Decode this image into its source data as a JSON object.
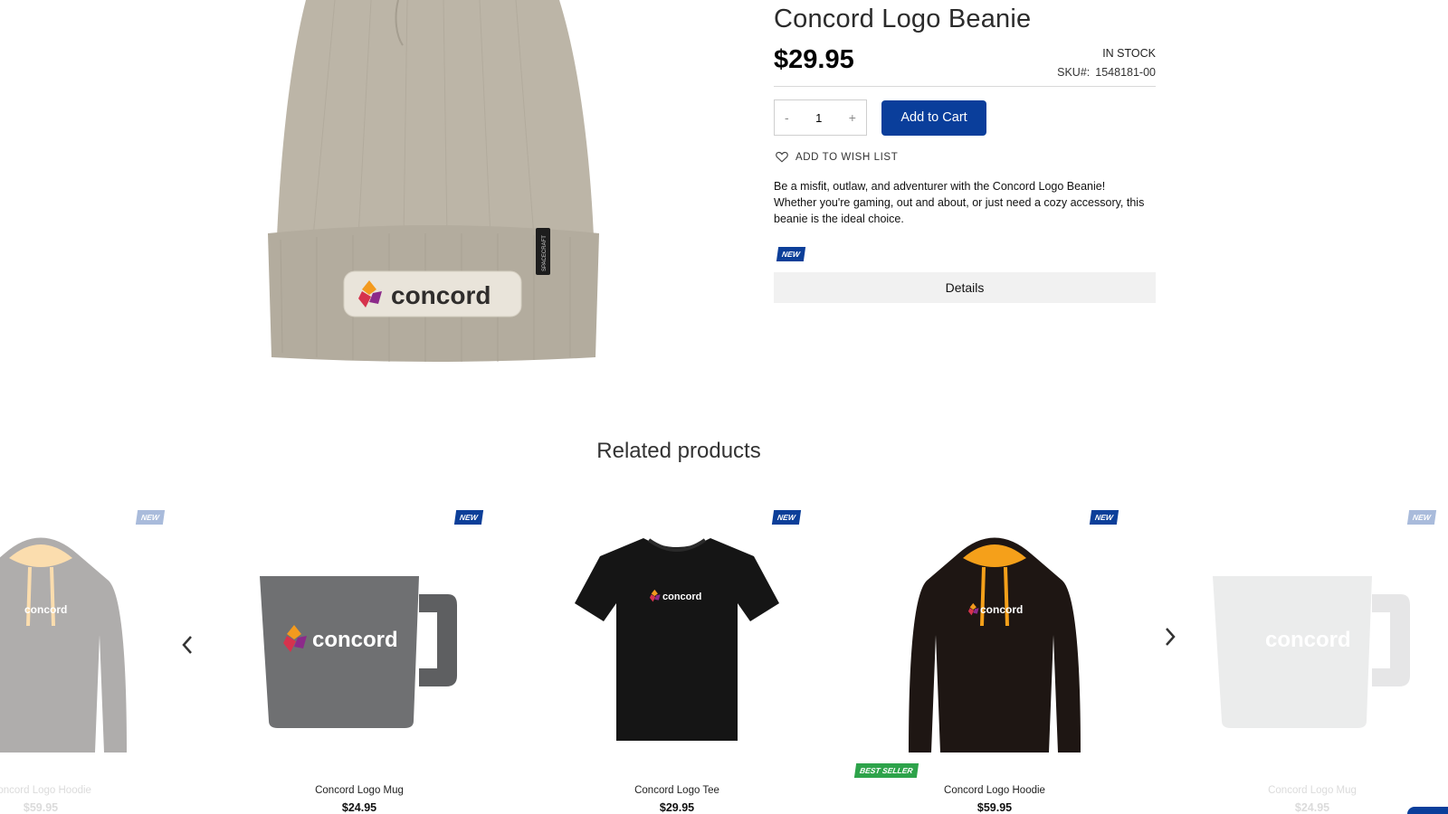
{
  "product": {
    "title": "Concord Logo Beanie",
    "price": "$29.95",
    "stock": "IN STOCK",
    "sku_label": "SKU#:",
    "sku_value": "1548181-00",
    "quantity": "1",
    "qty_minus": "-",
    "qty_plus": "+",
    "add_to_cart": "Add to Cart",
    "wish_list": "ADD TO WISH LIST",
    "description": "Be a misfit, outlaw, and adventurer with the Concord Logo Beanie! Whether you're gaming, out and about, or just need a cozy accessory, this beanie is the ideal choice.",
    "badge": "NEW",
    "details": "Details",
    "image_logo_text": "concord",
    "image_tag_text": "SPACECRAFT"
  },
  "related": {
    "title": "Related products",
    "items": [
      {
        "name": "Concord Logo Hoodie",
        "price": "$59.95",
        "badge": "NEW",
        "faded": true
      },
      {
        "name": "Concord Logo Mug",
        "price": "$24.95",
        "badge": "NEW"
      },
      {
        "name": "Concord Logo Tee",
        "price": "$29.95",
        "badge": "NEW"
      },
      {
        "name": "Concord Logo Hoodie",
        "price": "$59.95",
        "badge": "NEW",
        "badge2": "BEST SELLER"
      },
      {
        "name": "Concord Logo Mug",
        "price": "$24.95",
        "badge": "NEW",
        "faded": true
      }
    ],
    "image_logo_text": "concord"
  },
  "colors": {
    "accent": "#0a3e9b",
    "badge_new": "#0c3f99",
    "badge_bestseller": "#2da34a",
    "beanie": "#bcb5a7",
    "hoodie": "#1e1613",
    "hoodie_hood_lining": "#f5a01a",
    "mug": "#6f7072",
    "tee": "#151515"
  },
  "icons": {
    "wish": "heart-icon",
    "prev": "chevron-left-icon",
    "next": "chevron-right-icon"
  }
}
